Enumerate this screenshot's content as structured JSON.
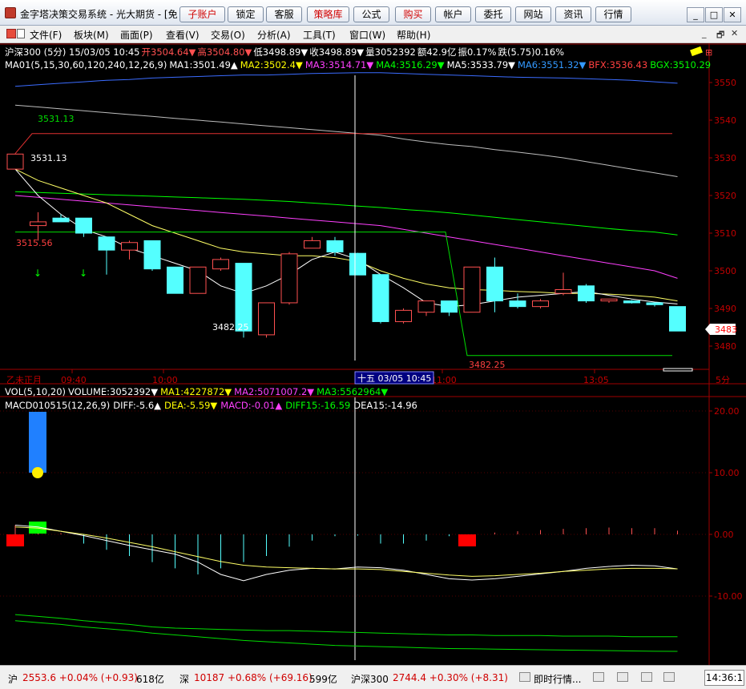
{
  "window": {
    "title": "金字塔决策交易系统 - 光大期货 - [免",
    "buttons": [
      "子账户",
      "锁定",
      "客服",
      "策略库",
      "公式",
      "购买",
      "帐户",
      "委托",
      "网站",
      "资讯",
      "行情"
    ],
    "min": "_",
    "max": "□",
    "close": "✕"
  },
  "menu": {
    "items": [
      "文件(F)",
      "板块(M)",
      "画面(P)",
      "查看(V)",
      "交易(O)",
      "分析(A)",
      "工具(T)",
      "窗口(W)",
      "帮助(H)"
    ],
    "controls": [
      "_",
      "🗗",
      "✕"
    ]
  },
  "main_panel": {
    "header": [
      {
        "text": "沪深300 (5分) 15/03/05 10:45",
        "color": "#ffffff"
      },
      {
        "text": "开3504.64▼",
        "color": "#ff5050"
      },
      {
        "text": "高3504.80▼",
        "color": "#ff5050"
      },
      {
        "text": "低3498.89▼",
        "color": "#ffffff"
      },
      {
        "text": "收3498.89▼",
        "color": "#ffffff"
      },
      {
        "text": "量3052392",
        "color": "#ffffff"
      },
      {
        "text": "额42.9亿",
        "color": "#ffffff"
      },
      {
        "text": "振0.17%",
        "color": "#ffffff"
      },
      {
        "text": "跌(5.75)0.16%",
        "color": "#ffffff"
      }
    ],
    "ma_line": [
      {
        "text": "MA01(5,15,30,60,120,240,12,26,9)",
        "color": "#ffffff"
      },
      {
        "text": "MA1:3501.49▲",
        "color": "#ffffff"
      },
      {
        "text": "MA2:3502.4▼",
        "color": "#ffff00"
      },
      {
        "text": "MA3:3514.71▼",
        "color": "#ff40ff"
      },
      {
        "text": "MA4:3516.29▼",
        "color": "#00ff00"
      },
      {
        "text": "MA5:3533.79▼",
        "color": "#ffffff"
      },
      {
        "text": "MA6:3551.32▼",
        "color": "#3399ff"
      },
      {
        "text": "BFX:3536.43",
        "color": "#ff4040"
      },
      {
        "text": "BGX:3510.29",
        "color": "#00ff00"
      }
    ],
    "annotations": [
      "3531.13",
      "3531.13",
      "3515.56",
      "3482.25",
      "3482.25"
    ],
    "time_labels": [
      "乙未正月",
      "09:40",
      "10:00",
      "11:00",
      "13:05"
    ],
    "cursor_label": "十五 03/05 10:45",
    "current_price": "3483",
    "period_label": "5分"
  },
  "price_axis": {
    "ticks": [
      "3550",
      "3540",
      "3530",
      "3520",
      "3510",
      "3500",
      "3490",
      "3480"
    ]
  },
  "lower_panel": {
    "vol_header": [
      {
        "text": "VOL(5,10,20)",
        "color": "#ffffff"
      },
      {
        "text": "VOLUME:3052392▼",
        "color": "#ffffff"
      },
      {
        "text": "MA1:4227872▼",
        "color": "#ffff00"
      },
      {
        "text": "MA2:5071007.2▼",
        "color": "#ff40ff"
      },
      {
        "text": "MA3:5562964▼",
        "color": "#00ff00"
      }
    ],
    "macd_header": [
      {
        "text": "MACD010515(12,26,9)",
        "color": "#ffffff"
      },
      {
        "text": "DIFF:-5.6▲",
        "color": "#ffffff"
      },
      {
        "text": "DEA:-5.59▼",
        "color": "#ffff00"
      },
      {
        "text": "MACD:-0.01▲",
        "color": "#ff40ff"
      },
      {
        "text": "DIFF15:-16.59",
        "color": "#00ff00"
      },
      {
        "text": "DEA15:-14.96",
        "color": "#ffffff"
      }
    ],
    "ticks": [
      "20.00",
      "10.00",
      "0.00",
      "-10.00"
    ]
  },
  "statusbar": {
    "segments": [
      {
        "text": "沪",
        "color": "#000000"
      },
      {
        "text": "2553.6 +0.04% (+0.93)",
        "color": "#d00000"
      },
      {
        "text": "618亿",
        "color": "#000000"
      },
      {
        "text": "深",
        "color": "#000000"
      },
      {
        "text": "10187 +0.68% (+69.16)",
        "color": "#d00000"
      },
      {
        "text": "599亿",
        "color": "#000000"
      },
      {
        "text": "沪深300",
        "color": "#000000"
      },
      {
        "text": "2744.4 +0.30% (+8.31)",
        "color": "#d00000"
      },
      {
        "text": "即时行情...",
        "color": "#000000"
      }
    ],
    "clock": "14:36:1"
  },
  "chart_data": {
    "type": "candlestick",
    "price_ylim": [
      3475,
      3555
    ],
    "candles": [
      {
        "o": 3527,
        "c": 3531,
        "h": 3531.13,
        "l": 3527,
        "up": true
      },
      {
        "o": 3512,
        "c": 3513,
        "h": 3515.56,
        "l": 3508,
        "up": true
      },
      {
        "o": 3513,
        "c": 3514,
        "h": 3515,
        "l": 3513,
        "up": false
      },
      {
        "o": 3514,
        "c": 3510,
        "h": 3514,
        "l": 3509,
        "up": false
      },
      {
        "o": 3509,
        "c": 3505.5,
        "h": 3509,
        "l": 3499,
        "up": false
      },
      {
        "o": 3505.5,
        "c": 3507.5,
        "h": 3508,
        "l": 3503,
        "up": true
      },
      {
        "o": 3508,
        "c": 3500.5,
        "h": 3508,
        "l": 3500,
        "up": false
      },
      {
        "o": 3501,
        "c": 3494,
        "h": 3501,
        "l": 3494,
        "up": false
      },
      {
        "o": 3494,
        "c": 3501,
        "h": 3501,
        "l": 3494,
        "up": true
      },
      {
        "o": 3500.5,
        "c": 3503,
        "h": 3503.5,
        "l": 3500,
        "up": true
      },
      {
        "o": 3502,
        "c": 3484,
        "h": 3502,
        "l": 3482.25,
        "up": false
      },
      {
        "o": 3483,
        "c": 3491.5,
        "h": 3491.5,
        "l": 3482.25,
        "up": true
      },
      {
        "o": 3491.5,
        "c": 3504.5,
        "h": 3505,
        "l": 3491,
        "up": true
      },
      {
        "o": 3506,
        "c": 3508,
        "h": 3509,
        "l": 3506,
        "up": true
      },
      {
        "o": 3508,
        "c": 3505,
        "h": 3509,
        "l": 3504,
        "up": false
      },
      {
        "o": 3504.64,
        "c": 3498.89,
        "h": 3504.8,
        "l": 3498.89,
        "up": false
      },
      {
        "o": 3499,
        "c": 3486.5,
        "h": 3499,
        "l": 3486,
        "up": false
      },
      {
        "o": 3486.5,
        "c": 3489.5,
        "h": 3490,
        "l": 3486,
        "up": true
      },
      {
        "o": 3489,
        "c": 3492,
        "h": 3492,
        "l": 3488,
        "up": true
      },
      {
        "o": 3492,
        "c": 3489,
        "h": 3492,
        "l": 3488,
        "up": false
      },
      {
        "o": 3489,
        "c": 3501,
        "h": 3501,
        "l": 3489,
        "up": true
      },
      {
        "o": 3501,
        "c": 3492,
        "h": 3503.5,
        "l": 3489,
        "up": false
      },
      {
        "o": 3492,
        "c": 3490.5,
        "h": 3494,
        "l": 3490,
        "up": false
      },
      {
        "o": 3490.5,
        "c": 3492,
        "h": 3492.5,
        "l": 3490,
        "up": true
      },
      {
        "o": 3494,
        "c": 3495,
        "h": 3499.5,
        "l": 3493.5,
        "up": true
      },
      {
        "o": 3496,
        "c": 3492,
        "h": 3496.5,
        "l": 3491.5,
        "up": false
      },
      {
        "o": 3492,
        "c": 3492.5,
        "h": 3492.5,
        "l": 3491.5,
        "up": true
      },
      {
        "o": 3492,
        "c": 3491.5,
        "h": 3492.2,
        "l": 3491.3,
        "up": false
      },
      {
        "o": 3491.5,
        "c": 3491,
        "h": 3491.5,
        "l": 3490.5,
        "up": false
      },
      {
        "o": 3490.5,
        "c": 3484,
        "h": 3490.5,
        "l": 3484,
        "up": false
      }
    ],
    "ma_series": [
      {
        "color": "#3b6cff",
        "values": [
          3549,
          3549.4,
          3549.8,
          3550.2,
          3550.6,
          3550.8,
          3551.2,
          3551.4,
          3551.6,
          3551.8,
          3552,
          3552,
          3552.2,
          3552.4,
          3552.5,
          3552.6,
          3552.6,
          3552.4,
          3552.2,
          3552,
          3551.8,
          3551.6,
          3551.4,
          3551.3,
          3551.2,
          3551,
          3550.8,
          3550.6,
          3550.2,
          3549.8
        ]
      },
      {
        "color": "#bdbdbd",
        "values": [
          3544,
          3543.5,
          3543,
          3542.5,
          3542,
          3541.5,
          3541,
          3540.5,
          3540,
          3539.5,
          3539,
          3538.5,
          3538,
          3537.5,
          3537,
          3536.5,
          3536,
          3535,
          3534.2,
          3533.5,
          3533,
          3532.2,
          3531.5,
          3530.8,
          3530,
          3529,
          3528,
          3527,
          3526,
          3525
        ]
      },
      {
        "color": "#00ff00",
        "values": [
          3521,
          3520.8,
          3520.6,
          3520.4,
          3520.2,
          3520,
          3519.8,
          3519.6,
          3519.4,
          3519.2,
          3519,
          3518.7,
          3518.4,
          3518,
          3517.6,
          3517.2,
          3516.8,
          3516.3,
          3515.9,
          3515.4,
          3514.8,
          3514.2,
          3513.6,
          3513,
          3512.4,
          3511.8,
          3511.2,
          3510.7,
          3510.3,
          3509.5
        ]
      },
      {
        "color": "#ff40ff",
        "values": [
          3520,
          3519.5,
          3519,
          3518.5,
          3518,
          3517.5,
          3517,
          3516.5,
          3516,
          3515.5,
          3515,
          3514.5,
          3514,
          3513.5,
          3513,
          3512.5,
          3512,
          3511,
          3510,
          3509,
          3508,
          3507,
          3506,
          3505,
          3504,
          3503,
          3502,
          3501,
          3500,
          3498
        ]
      },
      {
        "color": "#ffff66",
        "values": [
          3527,
          3524,
          3522,
          3520,
          3518,
          3515,
          3512,
          3510,
          3508,
          3506,
          3505,
          3504.5,
          3504,
          3504,
          3503.5,
          3502.5,
          3500,
          3498,
          3496.5,
          3495.5,
          3495,
          3494.8,
          3494.5,
          3494.3,
          3494,
          3494,
          3493.8,
          3493.5,
          3493,
          3492
        ]
      },
      {
        "color": "#ffffff",
        "values": [
          3527,
          3520,
          3515,
          3511,
          3509,
          3506,
          3504,
          3502,
          3500,
          3496,
          3494,
          3496,
          3499,
          3503,
          3505,
          3503,
          3499,
          3495.5,
          3491.5,
          3490.5,
          3491,
          3492,
          3493,
          3493.5,
          3494,
          3494.5,
          3493.5,
          3492.5,
          3491.7,
          3491.2
        ]
      }
    ],
    "bfx_levels": [
      3531.13,
      3536.43
    ],
    "bgx_levels": [
      3510.29,
      3477.5
    ],
    "vol_bar_value": 10.0,
    "macd_ylim": [
      -20,
      24
    ],
    "macd_hist": [
      1.5,
      1.2,
      0.2,
      -1.5,
      -2.5,
      -3.5,
      -4.5,
      -5.5,
      -6.5,
      -5.5,
      -4.5,
      -3.5,
      -2.0,
      -1.0,
      -0.3,
      -0.2,
      -1.5,
      -1.5,
      -1.0,
      -0.3,
      -0.1,
      0.3,
      0.5,
      0.7,
      0.9,
      1.0,
      1.1,
      1.0,
      1.0,
      0.6
    ],
    "diff": [
      1.5,
      1.2,
      0.5,
      -0.2,
      -1,
      -1.8,
      -2.5,
      -3.2,
      -4.5,
      -6.5,
      -7.5,
      -6.5,
      -5.8,
      -5.5,
      -5.6,
      -5.3,
      -5.4,
      -5.8,
      -6.5,
      -7.2,
      -7.4,
      -7.2,
      -6.8,
      -6.4,
      -6.0,
      -5.5,
      -5.2,
      -5.0,
      -5.1,
      -5.6
    ],
    "dea": [
      1.2,
      1.0,
      0.5,
      0.0,
      -0.6,
      -1.3,
      -2.0,
      -2.8,
      -3.6,
      -4.4,
      -5.0,
      -5.3,
      -5.4,
      -5.5,
      -5.6,
      -5.6,
      -5.7,
      -6.0,
      -6.3,
      -6.6,
      -6.8,
      -6.7,
      -6.5,
      -6.3,
      -6.0,
      -5.8,
      -5.6,
      -5.5,
      -5.5,
      -5.59
    ],
    "diff15": [
      -13,
      -13.3,
      -13.6,
      -14,
      -14.3,
      -14.6,
      -15,
      -15.2,
      -15.3,
      -15.4,
      -15.5,
      -15.6,
      -15.6,
      -15.7,
      -15.8,
      -15.9,
      -16,
      -16.1,
      -16.2,
      -16.3,
      -16.3,
      -16.4,
      -16.4,
      -16.4,
      -16.5,
      -16.5,
      -16.5,
      -16.6,
      -16.6,
      -16.59
    ],
    "dea15": [
      -14,
      -14.3,
      -14.6,
      -15,
      -15.3,
      -15.6,
      -16,
      -16.3,
      -16.6,
      -16.9,
      -17.2,
      -17.4,
      -17.6,
      -17.8,
      -18,
      -18.1,
      -18.2,
      -18.3,
      -18.4,
      -18.5,
      -18.55,
      -18.6,
      -18.65,
      -18.7,
      -18.75,
      -18.8,
      -18.85,
      -18.9,
      -18.95,
      -18.96
    ],
    "macd_signal_markers": [
      {
        "index": 0,
        "color": "#ff0000"
      },
      {
        "index": 1,
        "color": "#00ff00"
      },
      {
        "index": 21,
        "color": "#ff0000"
      }
    ],
    "down_arrows": [
      1,
      3
    ]
  }
}
